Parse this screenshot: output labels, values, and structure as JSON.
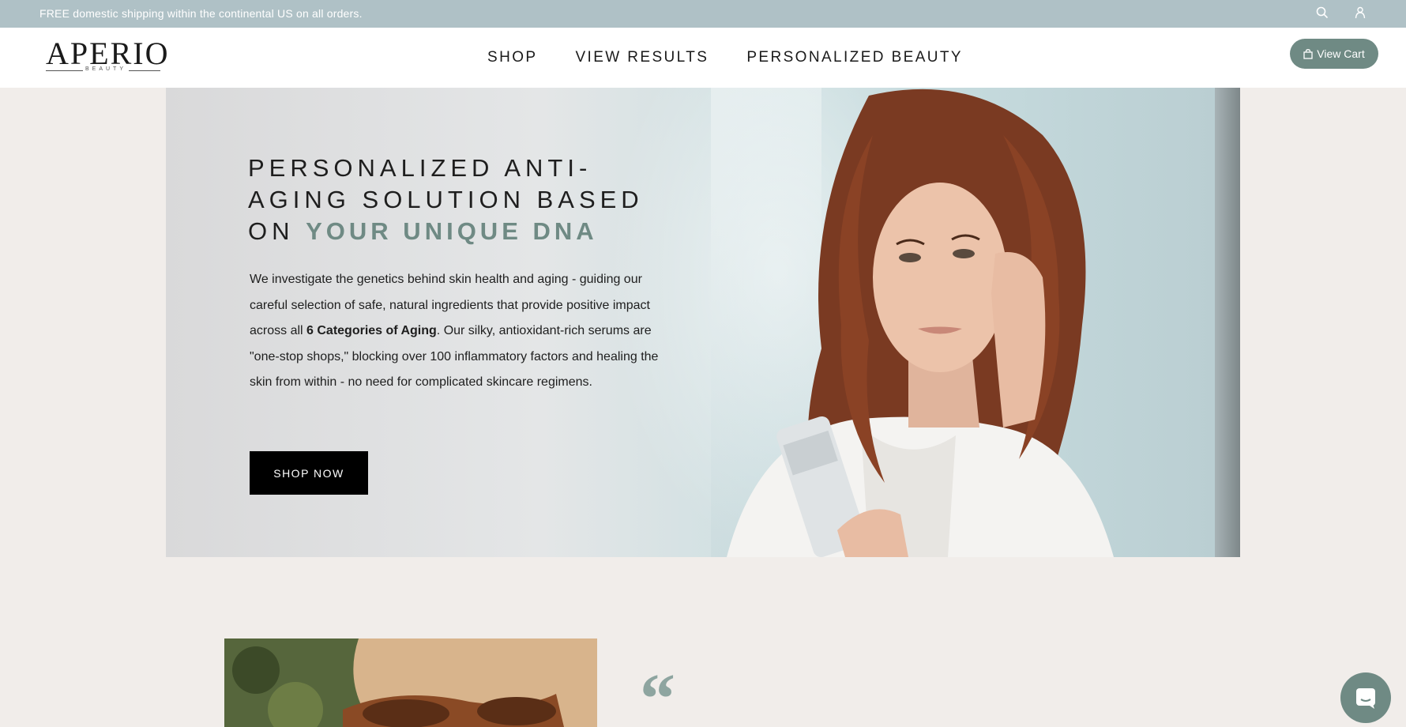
{
  "announcement": {
    "text": "FREE domestic shipping within the continental US on all orders."
  },
  "header": {
    "logo_main": "APERIO",
    "logo_sub": "BEAUTY",
    "nav": [
      "SHOP",
      "VIEW RESULTS",
      "PERSONALIZED BEAUTY"
    ],
    "cart_label": "View Cart"
  },
  "hero": {
    "title_part1": "PERSONALIZED ANTI-AGING SOLUTION BASED ON ",
    "title_accent": "YOUR UNIQUE DNA",
    "body_before": "We investigate the genetics behind skin health and aging - guiding our careful selection of safe, natural ingredients that provide positive impact across all ",
    "body_bold": "6 Categories of Aging",
    "body_after": ". Our silky, antioxidant-rich serums are \"one-stop shops,\" blocking over 100 inflammatory factors and healing the skin from within - no need for complicated skincare regimens.",
    "cta": "SHOP NOW"
  },
  "testimonial": {
    "quote_mark": "“"
  },
  "colors": {
    "accent": "#6f8a84",
    "announcement_bg": "#afc1c6",
    "page_bg": "#f1edea",
    "button_bg": "#000000"
  },
  "icons": {
    "search": "search-icon",
    "account": "account-icon",
    "cart": "bag-icon",
    "chat": "chat-icon"
  }
}
